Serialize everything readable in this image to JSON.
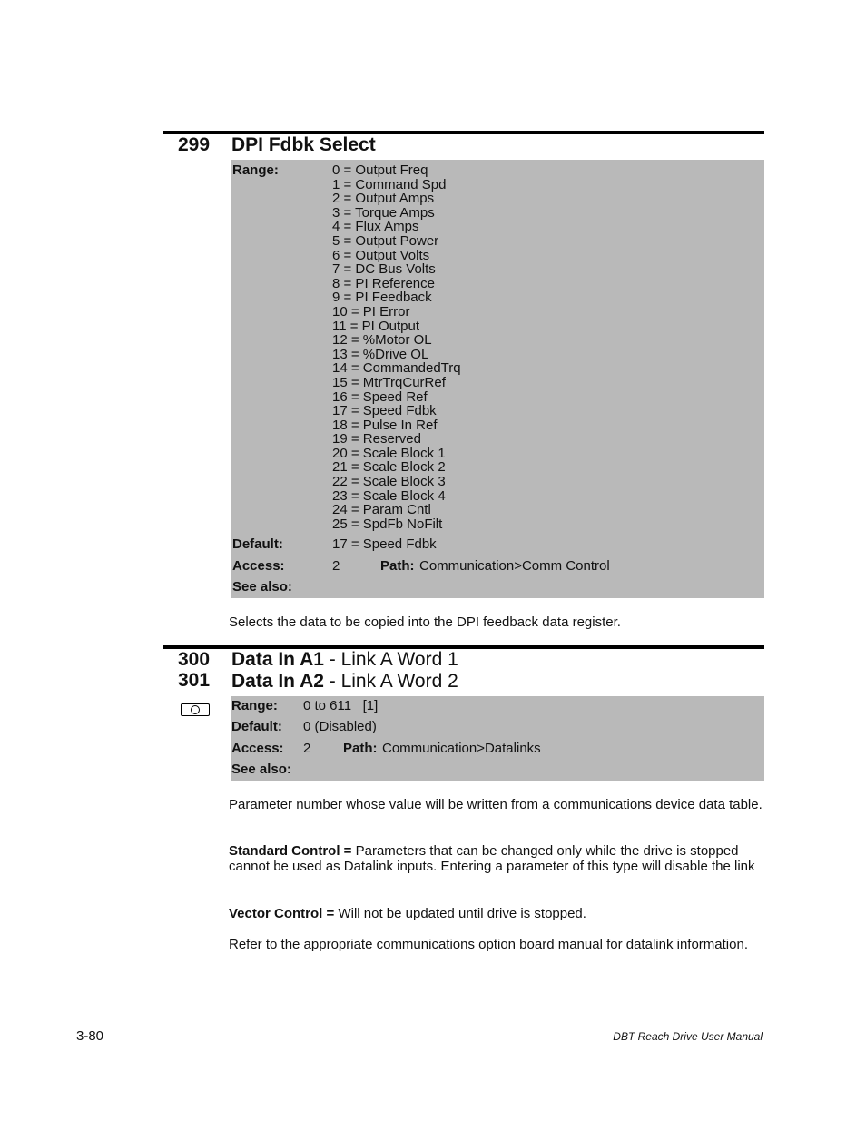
{
  "sections": [
    {
      "numbers": [
        "299"
      ],
      "titles": [
        {
          "bold": "DPI Fdbk Select",
          "normal": ""
        }
      ],
      "range_label": "Range:",
      "range_items": [
        "0 = Output Freq",
        "1 = Command Spd",
        "2 = Output Amps",
        "3 = Torque Amps",
        "4 = Flux Amps",
        "5 = Output Power",
        "6 = Output Volts",
        "7 = DC Bus Volts",
        "8 = PI Reference",
        "9 = PI Feedback",
        "10 = PI Error",
        "11 = PI Output",
        "12 = %Motor OL",
        "13 = %Drive OL",
        "14 = CommandedTrq",
        "15 = MtrTrqCurRef",
        "16 = Speed Ref",
        "17 = Speed Fdbk",
        "18 = Pulse In Ref",
        "19 = Reserved",
        "20 = Scale Block 1",
        "21 = Scale Block 2",
        "22 = Scale Block 3",
        "23 = Scale Block 4",
        "24 = Param Cntl",
        "25 = SpdFb NoFilt"
      ],
      "default_label": "Default:",
      "default_value": "17 = Speed Fdbk",
      "access_label": "Access:",
      "access_value": "2",
      "path_label": "Path:",
      "path_value": "Communication>Comm Control",
      "see_also_label": "See also:",
      "description": "Selects the data to be copied into the DPI feedback data register."
    },
    {
      "numbers": [
        "300",
        "301"
      ],
      "titles": [
        {
          "bold": "Data In A1",
          "normal": " - Link A Word 1"
        },
        {
          "bold": "Data In A2",
          "normal": " - Link A Word 2"
        }
      ],
      "icon": "stop-drive-icon",
      "range_label": "Range:",
      "range_value": "0 to 611   [1]",
      "default_label": "Default:",
      "default_value": "0 (Disabled)",
      "access_label": "Access:",
      "access_value": "2",
      "path_label": "Path:",
      "path_value": "Communication>Datalinks",
      "see_also_label": "See also:",
      "paragraphs": [
        {
          "bold": "",
          "text": "Parameter number whose value will be written from a communications device data table."
        },
        {
          "bold": "Standard Control =",
          "text": " Parameters that can be changed only while the drive is stopped cannot be used as Datalink inputs. Entering a parameter of this type will disable the link"
        },
        {
          "bold": "Vector Control =",
          "text": " Will not be updated until drive is stopped."
        },
        {
          "bold": "",
          "text": "Refer to the appropriate communications option board manual for datalink information."
        }
      ]
    }
  ],
  "footer": {
    "page_number": "3-80",
    "manual_title": "DBT Reach Drive User Manual"
  }
}
